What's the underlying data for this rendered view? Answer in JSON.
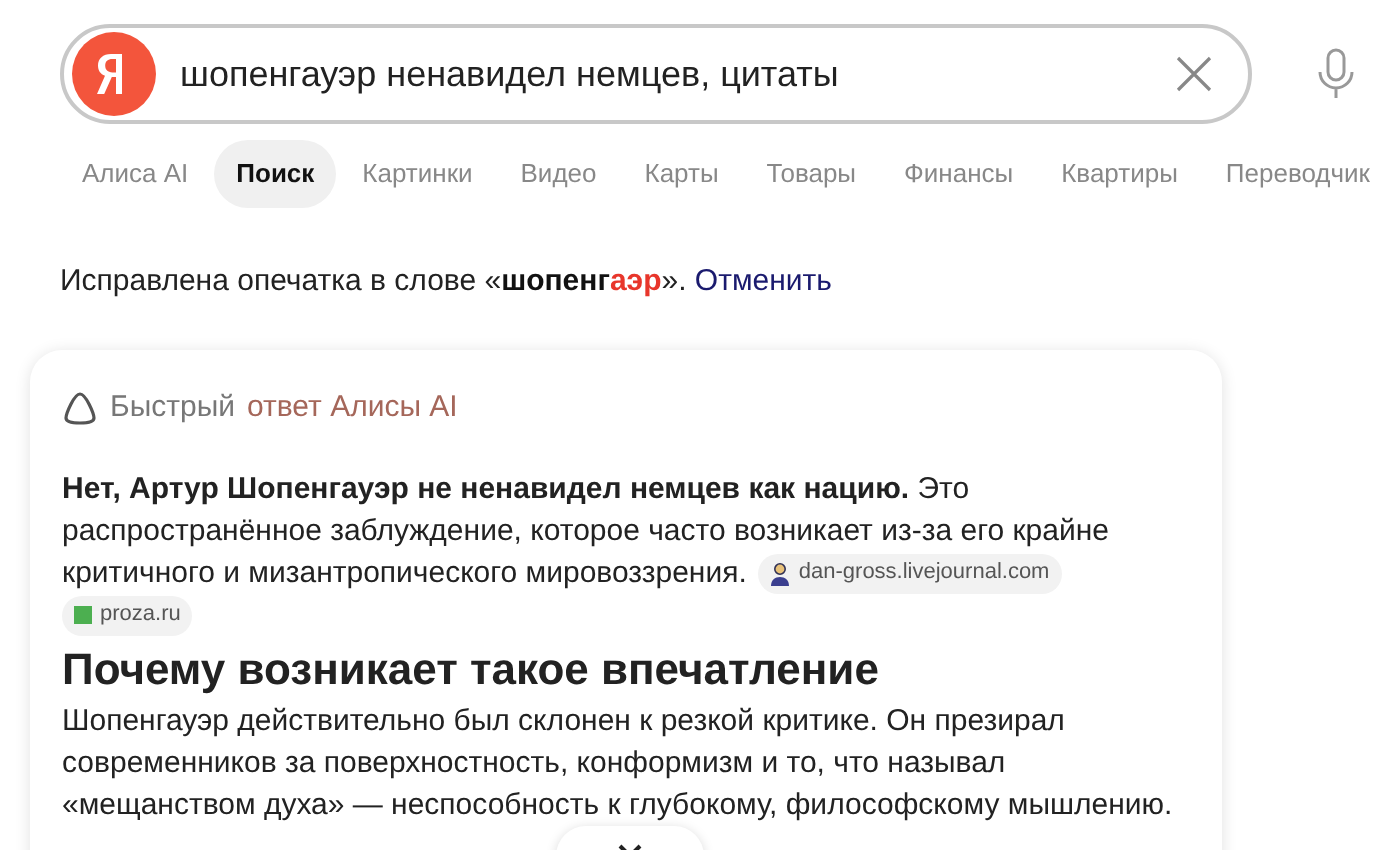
{
  "search": {
    "value": "шопенгауэр ненавидел немцев, цитаты"
  },
  "tabs": [
    {
      "label": "Алиса AI",
      "selected": false
    },
    {
      "label": "Поиск",
      "selected": true
    },
    {
      "label": "Картинки",
      "selected": false
    },
    {
      "label": "Видео",
      "selected": false
    },
    {
      "label": "Карты",
      "selected": false
    },
    {
      "label": "Товары",
      "selected": false
    },
    {
      "label": "Финансы",
      "selected": false
    },
    {
      "label": "Квартиры",
      "selected": false
    },
    {
      "label": "Переводчик",
      "selected": false
    }
  ],
  "correction": {
    "before": "Исправлена опечатка в слове «",
    "word": [
      {
        "text": "шопенг",
        "changed": false
      },
      {
        "text": "аэр",
        "changed": true
      }
    ],
    "after": "».",
    "link": "Отменить"
  },
  "answer": {
    "header": "Быстрый",
    "header_brand": "ответ Алисы AI",
    "text_lines": [
      "**Нет, Артур Шопенгауэр не ненавидел немцев как нацию.** Это",
      "распространённое заблуждение, которое часто возникает из-за его крайне",
      "критичного и мизантропического мировоззрения."
    ],
    "sources": [
      {
        "kind": "person",
        "label": "dan-gross.livejournal.com"
      },
      {
        "kind": "square",
        "label": "proza.ru",
        "color": "#4caf50"
      }
    ],
    "heading": "Почему возникает такое впечатление",
    "paragraph": "Шопенгауэр действительно был склонен к резкой критике. Он презирал современников за поверхностность, конформизм и то, что называл «мещанством духа» — неспособность к глубокому, философскому мышлению."
  }
}
